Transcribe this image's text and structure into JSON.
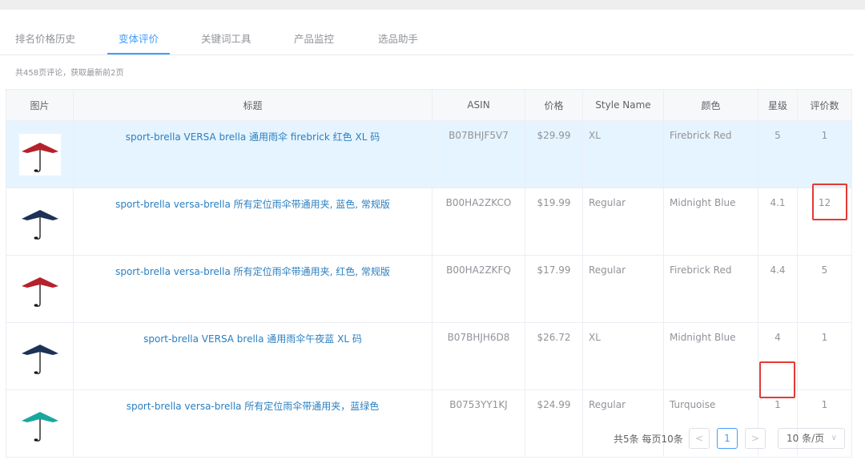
{
  "tabs": [
    {
      "label": "排名价格历史"
    },
    {
      "label": "变体评价"
    },
    {
      "label": "关键词工具"
    },
    {
      "label": "产品监控"
    },
    {
      "label": "选品助手"
    }
  ],
  "summary": "共458页评论，获取最新前2页",
  "table": {
    "headers": {
      "image": "图片",
      "title": "标题",
      "asin": "ASIN",
      "price": "价格",
      "style": "Style Name",
      "color": "颜色",
      "rating": "星级",
      "reviews": "评价数"
    },
    "rows": [
      {
        "title": "sport-brella VERSA brella 通用雨伞 firebrick 红色 XL 码",
        "asin": "B07BHJF5V7",
        "price": "$29.99",
        "style": "XL",
        "color": "Firebrick Red",
        "rating": "5",
        "reviews": "1",
        "canopy": "#b5212c",
        "highlighted": true
      },
      {
        "title": "sport-brella versa-brella 所有定位雨伞带通用夹, 蓝色, 常规版",
        "asin": "B00HA2ZKCO",
        "price": "$19.99",
        "style": "Regular",
        "color": "Midnight Blue",
        "rating": "4.1",
        "reviews": "12",
        "canopy": "#1c3257",
        "highlighted": false
      },
      {
        "title": "sport-brella versa-brella 所有定位雨伞带通用夹, 红色, 常规版",
        "asin": "B00HA2ZKFQ",
        "price": "$17.99",
        "style": "Regular",
        "color": "Firebrick Red",
        "rating": "4.4",
        "reviews": "5",
        "canopy": "#b5212c",
        "highlighted": false
      },
      {
        "title": "sport-brella VERSA brella 通用雨伞午夜蓝 XL 码",
        "asin": "B07BHJH6D8",
        "price": "$26.72",
        "style": "XL",
        "color": "Midnight Blue",
        "rating": "4",
        "reviews": "1",
        "canopy": "#1c3257",
        "highlighted": false
      },
      {
        "title": "sport-brella versa-brella 所有定位雨伞带通用夹，蓝绿色",
        "asin": "B0753YY1KJ",
        "price": "$24.99",
        "style": "Regular",
        "color": "Turquoise",
        "rating": "1",
        "reviews": "1",
        "canopy": "#1aa89e",
        "highlighted": false
      }
    ]
  },
  "pagination": {
    "info": "共5条 每页10条",
    "prev": "<",
    "current": "1",
    "next": ">",
    "page_size": "10 条/页"
  },
  "colors": {
    "accent": "#409eff",
    "link": "#2a7fc1",
    "highlight_row": "#e6f4ff",
    "annotation": "#e53935"
  },
  "icons": {
    "thumbnail": "umbrella-icon",
    "page_size_chevron": "chevron-down-icon"
  }
}
